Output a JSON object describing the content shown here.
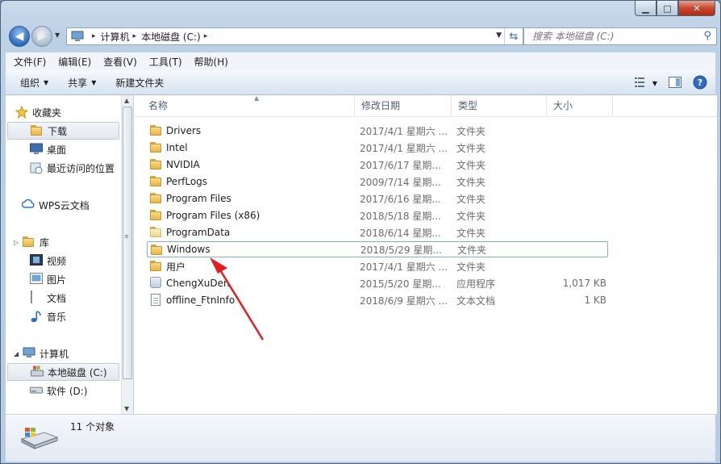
{
  "window": {
    "minimize": "▁",
    "maximize": "□",
    "close": "✕"
  },
  "address": {
    "crumbs": [
      "计算机",
      "本地磁盘 (C:)"
    ],
    "separator": "▸"
  },
  "search": {
    "placeholder": "搜索 本地磁盘 (C:)"
  },
  "menu": [
    "文件(F)",
    "编辑(E)",
    "查看(V)",
    "工具(T)",
    "帮助(H)"
  ],
  "toolbar": {
    "organize": "组织",
    "share": "共享",
    "new_folder": "新建文件夹"
  },
  "nav": {
    "favorites": "收藏夹",
    "downloads": "下载",
    "desktop": "桌面",
    "recent": "最近访问的位置",
    "wps": "WPS云文档",
    "libraries": "库",
    "videos": "视频",
    "pictures": "图片",
    "documents": "文档",
    "music": "音乐",
    "computer": "计算机",
    "local_disk": "本地磁盘 (C:)",
    "soft_disk": "软件 (D:)"
  },
  "columns": {
    "name": "名称",
    "date": "修改日期",
    "type": "类型",
    "size": "大小"
  },
  "files": [
    {
      "name": "Drivers",
      "date": "2017/4/1 星期六 ...",
      "type": "文件夹",
      "size": "",
      "icon": "folder-icon"
    },
    {
      "name": "Intel",
      "date": "2017/4/1 星期六 ...",
      "type": "文件夹",
      "size": "",
      "icon": "folder-icon"
    },
    {
      "name": "NVIDIA",
      "date": "2017/6/17 星期...",
      "type": "文件夹",
      "size": "",
      "icon": "folder-icon"
    },
    {
      "name": "PerfLogs",
      "date": "2009/7/14 星期...",
      "type": "文件夹",
      "size": "",
      "icon": "folder-icon"
    },
    {
      "name": "Program Files",
      "date": "2017/6/16 星期...",
      "type": "文件夹",
      "size": "",
      "icon": "folder-icon"
    },
    {
      "name": "Program Files (x86)",
      "date": "2018/5/18 星期...",
      "type": "文件夹",
      "size": "",
      "icon": "folder-icon"
    },
    {
      "name": "ProgramData",
      "date": "2018/6/14 星期...",
      "type": "文件夹",
      "size": "",
      "icon": "folder-icon"
    },
    {
      "name": "Windows",
      "date": "2018/5/29 星期...",
      "type": "文件夹",
      "size": "",
      "icon": "folder-icon"
    },
    {
      "name": "用户",
      "date": "2017/4/1 星期六 ...",
      "type": "文件夹",
      "size": "",
      "icon": "folder-icon"
    },
    {
      "name": "ChengXuDen",
      "date": "2015/5/20 星期...",
      "type": "应用程序",
      "size": "1,017 KB",
      "icon": "application-icon"
    },
    {
      "name": "offline_FtnInfo",
      "date": "2018/6/9 星期六 ...",
      "type": "文本文档",
      "size": "1 KB",
      "icon": "text-document-icon"
    }
  ],
  "status": {
    "count": "11 个对象"
  },
  "colors": {
    "accent": "#3a6fb0",
    "annotation_arrow": "#e02020"
  }
}
